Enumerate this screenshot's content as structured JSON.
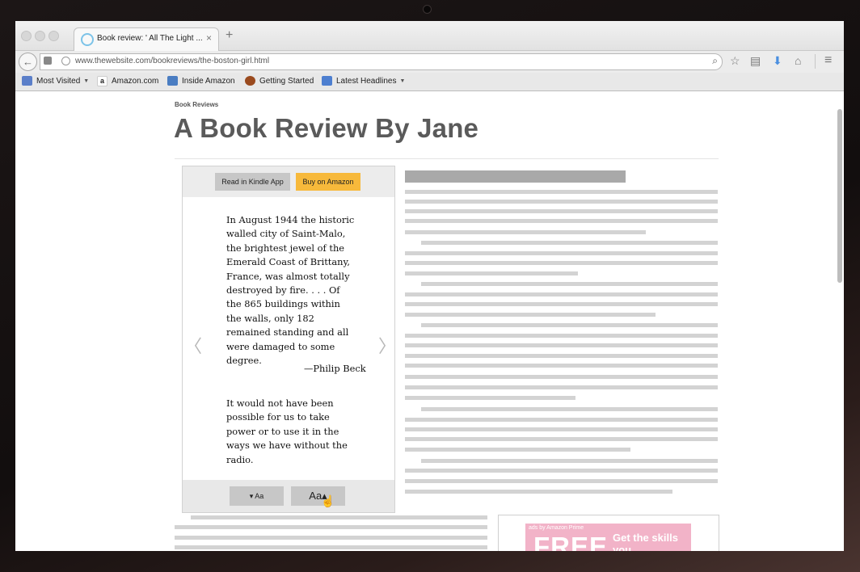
{
  "browser": {
    "tab_title": "Book review: ' All The Light  ...",
    "tab_close": "×",
    "new_tab": "+",
    "back_symbol": "←",
    "url": "www.thewebsite.com/bookreviews/the-boston-girl.html",
    "search_symbol": "⌕",
    "toolbar_icons": [
      "star-icon",
      "reading-list-icon",
      "download-icon",
      "home-icon",
      "menu-icon"
    ],
    "icon_glyphs": {
      "star": "☆",
      "reading": "▤",
      "download": "⬇",
      "home": "⌂",
      "menu": "≡"
    }
  },
  "bookmarks": [
    {
      "label": "Most Visited",
      "has_caret": true,
      "icon": "most-visited-icon",
      "color": "#5b7fc9"
    },
    {
      "label": "Amazon.com",
      "has_caret": false,
      "icon": "amazon-icon",
      "color": "#ffffff"
    },
    {
      "label": "Inside Amazon",
      "has_caret": false,
      "icon": "inside-amazon-icon",
      "color": "#4a7dc2"
    },
    {
      "label": "Getting Started",
      "has_caret": false,
      "icon": "getting-started-icon",
      "color": "#9a4a1e"
    },
    {
      "label": "Latest Headlines",
      "has_caret": true,
      "icon": "rss-icon",
      "color": "#4d7fd0"
    }
  ],
  "page": {
    "kicker": "Book Reviews",
    "headline": "A Book Review By Jane"
  },
  "kindle_widget": {
    "read_button": "Read in Kindle App",
    "buy_button": "Buy on Amazon",
    "quote": "In August 1944 the historic walled city of Saint-Malo, the brightest jewel of the Emerald Coast of Brittany, France, was almost totally destroyed by fire. . . . Of the 865 buildings within the walls, only 182 remained standing and all were damaged to some degree.",
    "attribution": "—Philip Beck",
    "paragraph": "It would not have been possible for us to take power or to use it in the ways we have without the radio.",
    "prev_arrow": "〈",
    "next_arrow": "〉",
    "font_decrease": "▾ Aa",
    "font_increase": "Aa▴"
  },
  "ad": {
    "small_text": "ads by Amazon Prime",
    "headline": "FREE",
    "tagline": "Get the skills you"
  },
  "colors": {
    "buy_button": "#f7b93b",
    "placeholder_title": "#a9a9a9",
    "placeholder_line": "#d3d3d3"
  }
}
